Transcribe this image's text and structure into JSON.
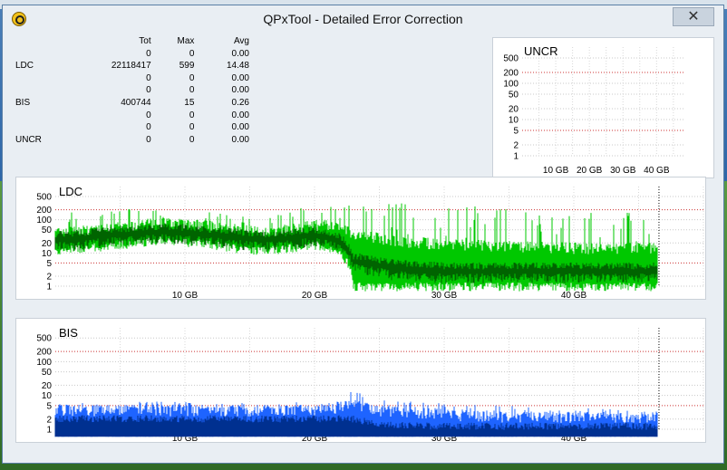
{
  "window": {
    "title": "QPxTool - Detailed Error Correction",
    "close_symbol": "✕"
  },
  "stats": {
    "headers": [
      "Tot",
      "Max",
      "Avg"
    ],
    "rows": [
      {
        "label": "",
        "tot": "0",
        "max": "0",
        "avg": "0.00"
      },
      {
        "label": "LDC",
        "tot": "22118417",
        "max": "599",
        "avg": "14.48"
      },
      {
        "label": "",
        "tot": "0",
        "max": "0",
        "avg": "0.00"
      },
      {
        "label": "",
        "tot": "0",
        "max": "0",
        "avg": "0.00"
      },
      {
        "label": "BIS",
        "tot": "400744",
        "max": "15",
        "avg": "0.26"
      },
      {
        "label": "",
        "tot": "0",
        "max": "0",
        "avg": "0.00"
      },
      {
        "label": "",
        "tot": "0",
        "max": "0",
        "avg": "0.00"
      },
      {
        "label": "UNCR",
        "tot": "0",
        "max": "0",
        "avg": "0.00"
      }
    ]
  },
  "chart_data": [
    {
      "type": "area",
      "title": "UNCR",
      "y_scale": "log",
      "yticks": [
        1,
        2,
        5,
        10,
        20,
        50,
        100,
        200,
        500
      ],
      "xticks": [
        "10 GB",
        "20 GB",
        "30 GB",
        "40 GB"
      ],
      "xlim": [
        0,
        48
      ],
      "series": [
        {
          "values": []
        }
      ],
      "colors": {
        "fill": "#00a000"
      }
    },
    {
      "type": "area",
      "title": "LDC",
      "y_scale": "log",
      "yticks": [
        1,
        2,
        5,
        10,
        20,
        50,
        100,
        200,
        500
      ],
      "xticks": [
        "10 GB",
        "20 GB",
        "30 GB",
        "40 GB"
      ],
      "xlim": [
        0,
        50
      ],
      "series": [
        {
          "x": [
            0,
            2,
            4,
            6,
            8,
            10,
            12,
            14,
            16,
            18,
            20,
            22,
            23,
            26,
            30,
            34,
            38,
            42,
            46.5
          ],
          "max": [
            150,
            180,
            200,
            230,
            250,
            230,
            200,
            180,
            160,
            200,
            260,
            350,
            450,
            350,
            300,
            250,
            200,
            180,
            150
          ],
          "mid": [
            45,
            50,
            60,
            75,
            85,
            80,
            70,
            55,
            45,
            55,
            75,
            70,
            40,
            25,
            20,
            18,
            16,
            15,
            15
          ],
          "low": [
            12,
            14,
            16,
            20,
            25,
            22,
            18,
            14,
            12,
            14,
            18,
            10,
            1,
            1,
            1,
            1,
            1,
            1,
            1
          ],
          "dark_mid": [
            35,
            40,
            48,
            55,
            62,
            58,
            50,
            42,
            35,
            40,
            50,
            30,
            8,
            5,
            4,
            4,
            4,
            4,
            4
          ]
        }
      ],
      "colors": {
        "bright": "#00c800",
        "dark": "#006400"
      }
    },
    {
      "type": "area",
      "title": "BIS",
      "y_scale": "log",
      "yticks": [
        1,
        2,
        5,
        10,
        20,
        50,
        100,
        200,
        500
      ],
      "xticks": [
        "10 GB",
        "20 GB",
        "30 GB",
        "40 GB"
      ],
      "xlim": [
        0,
        50
      ],
      "series": [
        {
          "x": [
            0,
            4,
            8,
            12,
            16,
            20,
            22,
            23,
            25,
            30,
            35,
            40,
            46.5
          ],
          "max": [
            6,
            6,
            7,
            6,
            6,
            7,
            8,
            14,
            8,
            6,
            5,
            5,
            4
          ],
          "mid": [
            4,
            4,
            4,
            4,
            4,
            4,
            5,
            6,
            4,
            3,
            2.5,
            2.5,
            2.5
          ],
          "dark_mid": [
            2,
            2,
            2,
            2,
            2,
            2,
            2,
            2,
            1.3,
            1.2,
            1.2,
            1.2,
            1.2
          ]
        }
      ],
      "colors": {
        "bright": "#1e64ff",
        "dark": "#003090"
      }
    }
  ]
}
